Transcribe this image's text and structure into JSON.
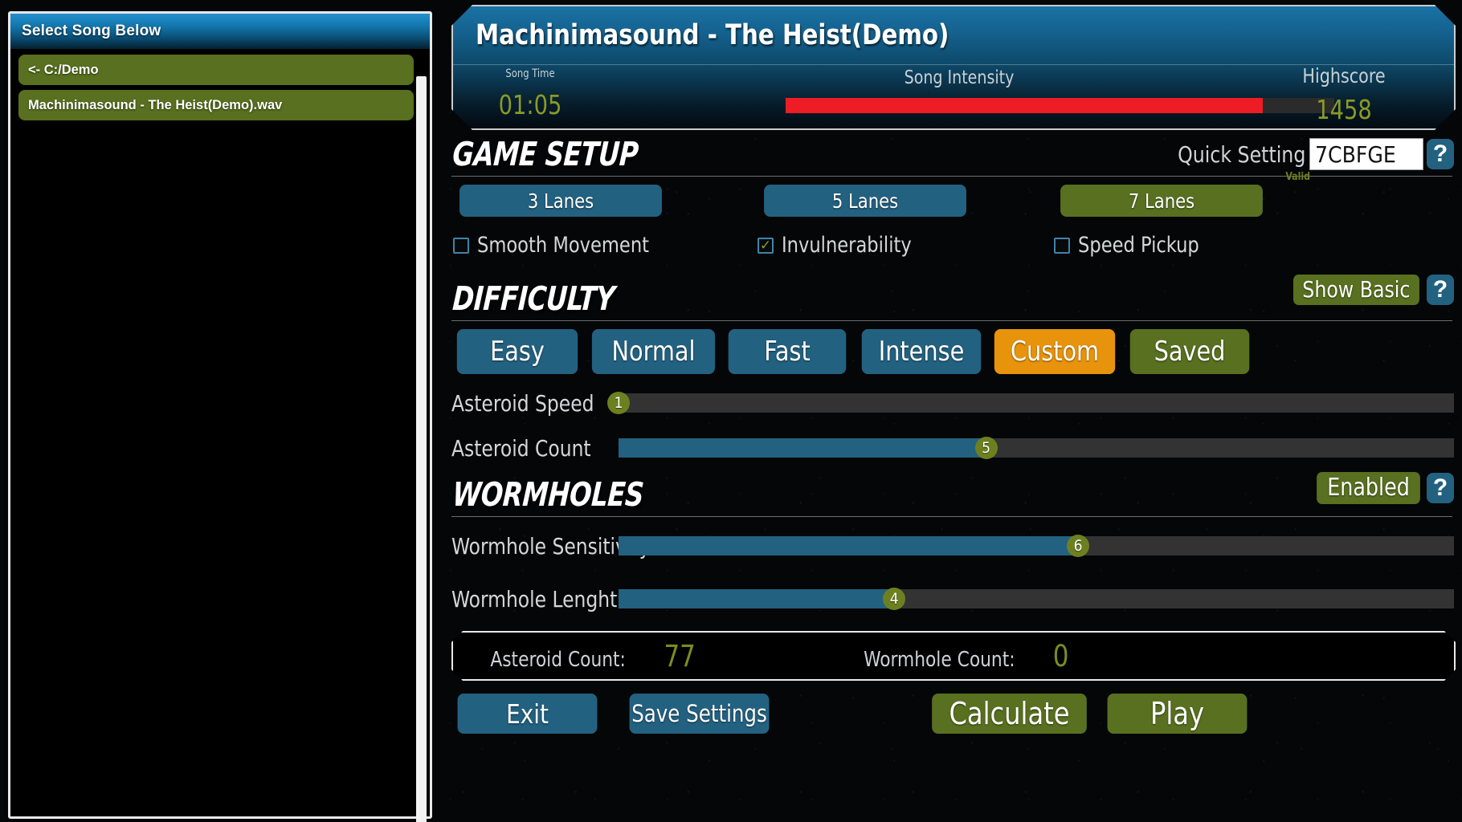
{
  "song_panel": {
    "header": "Select Song Below",
    "items": [
      {
        "label": "<- C:/Demo",
        "type": "directory"
      },
      {
        "label": "Machinimasound - The Heist(Demo).wav",
        "type": "file"
      }
    ]
  },
  "banner": {
    "title": "Machinimasound - The Heist(Demo)",
    "song_time_label": "Song Time",
    "song_time_value": "01:05",
    "intensity_label": "Song Intensity",
    "intensity_percent": 87,
    "highscore_label": "Highscore",
    "highscore_value": "1458"
  },
  "game_setup": {
    "title": "GAME SETUP",
    "quick_setting_label": "Quick Setting",
    "quick_setting_value": "7CBFGE",
    "quick_setting_status": "Valid",
    "help_label": "?",
    "lanes": [
      {
        "label": "3 Lanes",
        "selected": false
      },
      {
        "label": "5 Lanes",
        "selected": false
      },
      {
        "label": "7 Lanes",
        "selected": true
      }
    ],
    "checkboxes": [
      {
        "label": "Smooth Movement",
        "checked": false,
        "mark": ""
      },
      {
        "label": "Invulnerability",
        "checked": true,
        "mark": "✓"
      },
      {
        "label": "Speed Pickup",
        "checked": false,
        "mark": ""
      }
    ]
  },
  "difficulty": {
    "title": "DIFFICULTY",
    "show_basic_label": "Show Basic",
    "help_label": "?",
    "presets": [
      {
        "label": "Easy",
        "state": "normal"
      },
      {
        "label": "Normal",
        "state": "normal"
      },
      {
        "label": "Fast",
        "state": "normal"
      },
      {
        "label": "Intense",
        "state": "normal"
      },
      {
        "label": "Custom",
        "state": "active"
      },
      {
        "label": "Saved",
        "state": "saved"
      }
    ],
    "sliders": [
      {
        "label": "Asteroid Speed",
        "value": "1",
        "percent": 0
      },
      {
        "label": "Asteroid Count",
        "value": "5",
        "percent": 44
      }
    ]
  },
  "wormholes": {
    "title": "WORMHOLES",
    "toggle_label": "Enabled",
    "help_label": "?",
    "sliders": [
      {
        "label": "Wormhole Sensitivity",
        "value": "6",
        "percent": 55
      },
      {
        "label": "Wormhole Lenght",
        "value": "4",
        "percent": 33
      }
    ]
  },
  "summary": {
    "asteroid_count_label": "Asteroid Count:",
    "asteroid_count_value": "77",
    "wormhole_count_label": "Wormhole Count:",
    "wormhole_count_value": "0"
  },
  "actions": {
    "exit": "Exit",
    "save_settings": "Save Settings",
    "calculate": "Calculate",
    "play": "Play"
  },
  "colors": {
    "blue": "#236180",
    "green": "#58701f",
    "orange": "#e8930c",
    "value_green": "#8a9a27",
    "intensity_red": "#ee1c25"
  }
}
